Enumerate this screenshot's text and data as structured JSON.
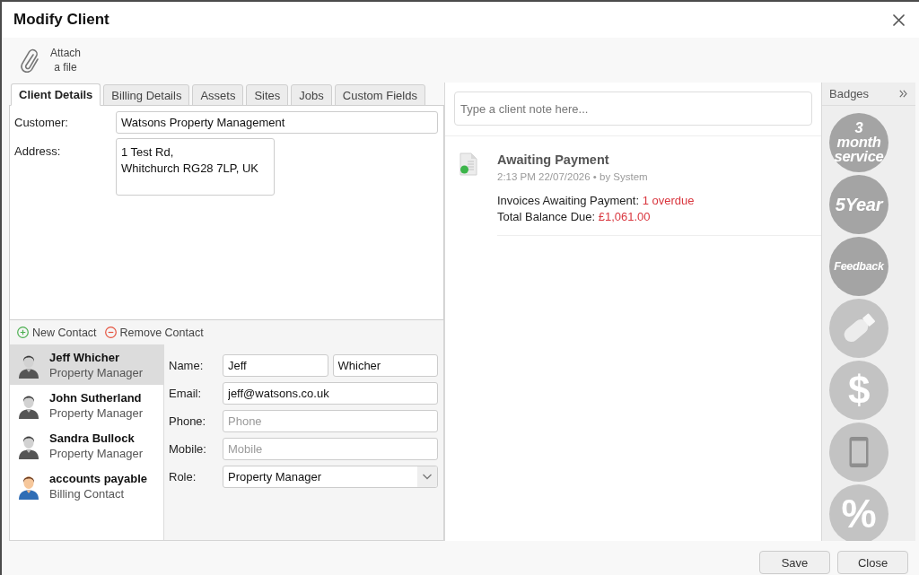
{
  "window": {
    "title": "Modify Client"
  },
  "toolbar": {
    "attach_label": "Attach a file"
  },
  "tabs": [
    {
      "label": "Client Details",
      "selected": true
    },
    {
      "label": "Billing Details",
      "selected": false
    },
    {
      "label": "Assets",
      "selected": false
    },
    {
      "label": "Sites",
      "selected": false
    },
    {
      "label": "Jobs",
      "selected": false
    },
    {
      "label": "Custom Fields",
      "selected": false
    }
  ],
  "client_details": {
    "customer": {
      "label": "Customer:",
      "value": "Watsons Property Management"
    },
    "address": {
      "label": "Address:",
      "lines": [
        "1 Test Rd,",
        "Whitchurch RG28 7LP, UK"
      ]
    }
  },
  "contact_actions": [
    {
      "kind": "add",
      "label": "New Contact"
    },
    {
      "kind": "remove",
      "label": "Remove Contact"
    }
  ],
  "contacts": [
    {
      "kind": "silhouette",
      "name": "Jeff Whicher",
      "role": "Property Manager",
      "selected": true
    },
    {
      "kind": "silhouette",
      "name": "John Sutherland",
      "role": "Property Manager",
      "selected": false
    },
    {
      "kind": "silhouette",
      "name": "Sandra Bullock",
      "role": "Property Manager",
      "selected": false
    },
    {
      "kind": "illustrated",
      "name": "accounts payable",
      "role": "Billing Contact",
      "selected": false
    }
  ],
  "contact_form": {
    "name": {
      "label": "Name:",
      "first": "Jeff",
      "last": "Whicher"
    },
    "fields": [
      {
        "label": "Email:",
        "value": "jeff@watsons.co.uk"
      },
      {
        "label": "Phone:",
        "placeholder": "Phone"
      },
      {
        "label": "Mobile:",
        "placeholder": "Mobile"
      }
    ],
    "role": {
      "label": "Role:",
      "value": "Property Manager"
    }
  },
  "notes": {
    "placeholder": "Type a client note here..."
  },
  "activity": [
    {
      "title": "Awaiting Payment",
      "meta": "2:13 PM 22/07/2026 • by System",
      "lines": [
        {
          "label": "Invoices Awaiting Payment:",
          "value": "1 overdue"
        },
        {
          "label": "Total Balance Due:",
          "value": "£1,061.00"
        }
      ]
    }
  ],
  "badges": {
    "title": "Badges",
    "items": [
      {
        "kind": "text",
        "lines": [
          "3",
          "month",
          "service"
        ],
        "earned": true
      },
      {
        "kind": "text",
        "lines": [
          "5Year"
        ],
        "earned": true
      },
      {
        "kind": "text",
        "lines": [
          "Feedback"
        ],
        "earned": true
      },
      {
        "kind": "usb",
        "earned": false
      },
      {
        "kind": "text",
        "lines": [
          "$"
        ],
        "earned": false
      },
      {
        "kind": "phone",
        "earned": false
      },
      {
        "kind": "text",
        "lines": [
          "%"
        ],
        "earned": false
      }
    ]
  },
  "footer": {
    "buttons": [
      "Save",
      "Close"
    ]
  }
}
